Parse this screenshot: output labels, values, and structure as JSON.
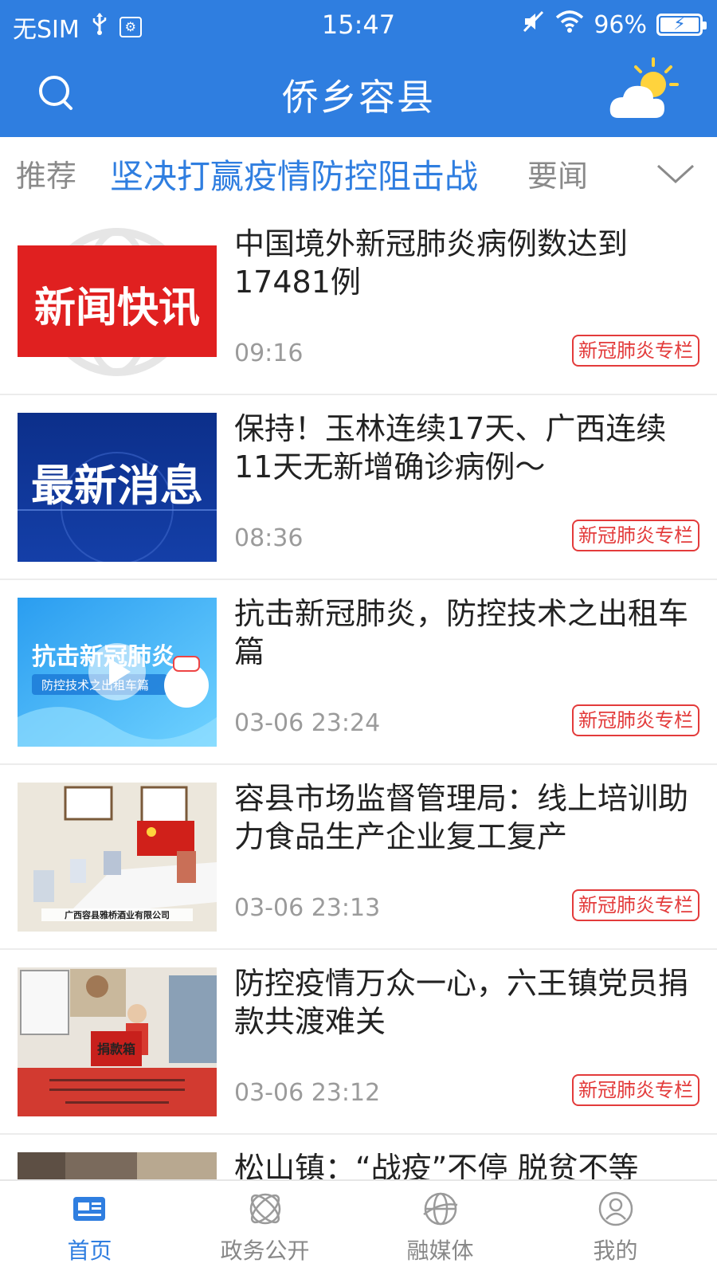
{
  "status_bar": {
    "carrier": "无SIM",
    "time": "15:47",
    "battery": "96%",
    "battery_level": 0.96,
    "usb_icon": "usb-icon",
    "debug_icon": "usb-debug-icon",
    "mute_icon": "mute-icon",
    "wifi_icon": "wifi-icon"
  },
  "header": {
    "title": "侨乡容县",
    "search_icon": "search-icon",
    "weather_icon": "partly-cloudy-icon"
  },
  "tabs": [
    {
      "label": "推荐",
      "active": false
    },
    {
      "label": "坚决打赢疫情防控阻击战",
      "active": true
    },
    {
      "label": "要闻",
      "active": false
    }
  ],
  "tabs_more_icon": "chevron-down-icon",
  "news": [
    {
      "title": "中国境外新冠肺炎病例数达到17481例",
      "time": "09:16",
      "tag": "新冠肺炎专栏",
      "thumb_text": "新闻快讯"
    },
    {
      "title": "保持！玉林连续17天、广西连续11天无新增确诊病例～",
      "time": "08:36",
      "tag": "新冠肺炎专栏",
      "thumb_text": "最新消息"
    },
    {
      "title": "抗击新冠肺炎，防控技术之出租车篇",
      "time": "03-06 23:24",
      "tag": "新冠肺炎专栏",
      "thumb_text": "抗击新冠肺炎",
      "thumb_subtext": "防控技术之出租车篇"
    },
    {
      "title": "容县市场监督管理局：线上培训助力食品生产企业复工复产",
      "time": "03-06 23:13",
      "tag": "新冠肺炎专栏",
      "thumb_caption": "广西容县雅桥酒业有限公司"
    },
    {
      "title": "防控疫情万众一心，六王镇党员捐款共渡难关",
      "time": "03-06 23:12",
      "tag": "新冠肺炎专栏",
      "thumb_caption": "捐款箱"
    },
    {
      "title": "松山镇：“战疫”不停 脱贫不等"
    }
  ],
  "bottom_nav": [
    {
      "label": "首页",
      "icon": "news-home-icon",
      "active": true
    },
    {
      "label": "政务公开",
      "icon": "orbit-icon",
      "active": false
    },
    {
      "label": "融媒体",
      "icon": "globe-icon",
      "active": false
    },
    {
      "label": "我的",
      "icon": "user-icon",
      "active": false
    }
  ],
  "colors": {
    "brand_blue": "#2f7ee0",
    "tag_red": "#e33b3b"
  }
}
